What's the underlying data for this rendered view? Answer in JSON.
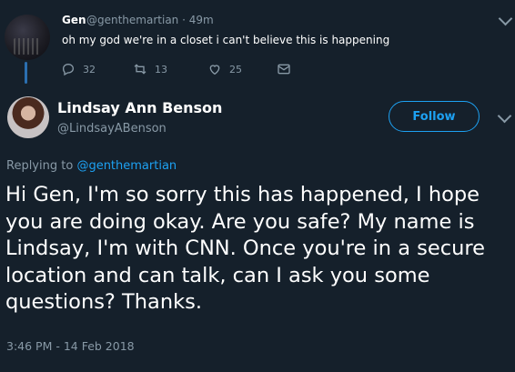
{
  "parent_tweet": {
    "name": "Gen",
    "handle": "@genthemartian · 49m",
    "text": "oh my god we're in a closet i can't believe this is happening",
    "reply_count": "32",
    "retweet_count": "13",
    "like_count": "25"
  },
  "main_tweet": {
    "name": "Lindsay Ann Benson",
    "handle": "@LindsayABenson",
    "follow_label": "Follow",
    "replying_prefix": "Replying to ",
    "replying_mention": "@genthemartian",
    "text": "Hi Gen, I'm so sorry this has happened, I hope you are doing okay. Are you safe? My name is Lindsay, I'm with CNN. Once you're in a secure location and can talk, can I ask you some questions? Thanks.",
    "timestamp": "3:46 PM - 14 Feb 2018"
  },
  "colors": {
    "background": "#15202b",
    "accent": "#1da1f2",
    "muted": "#8899a6"
  },
  "icons": [
    "reply-icon",
    "retweet-icon",
    "like-icon",
    "direct-message-icon",
    "chevron-down-icon"
  ]
}
